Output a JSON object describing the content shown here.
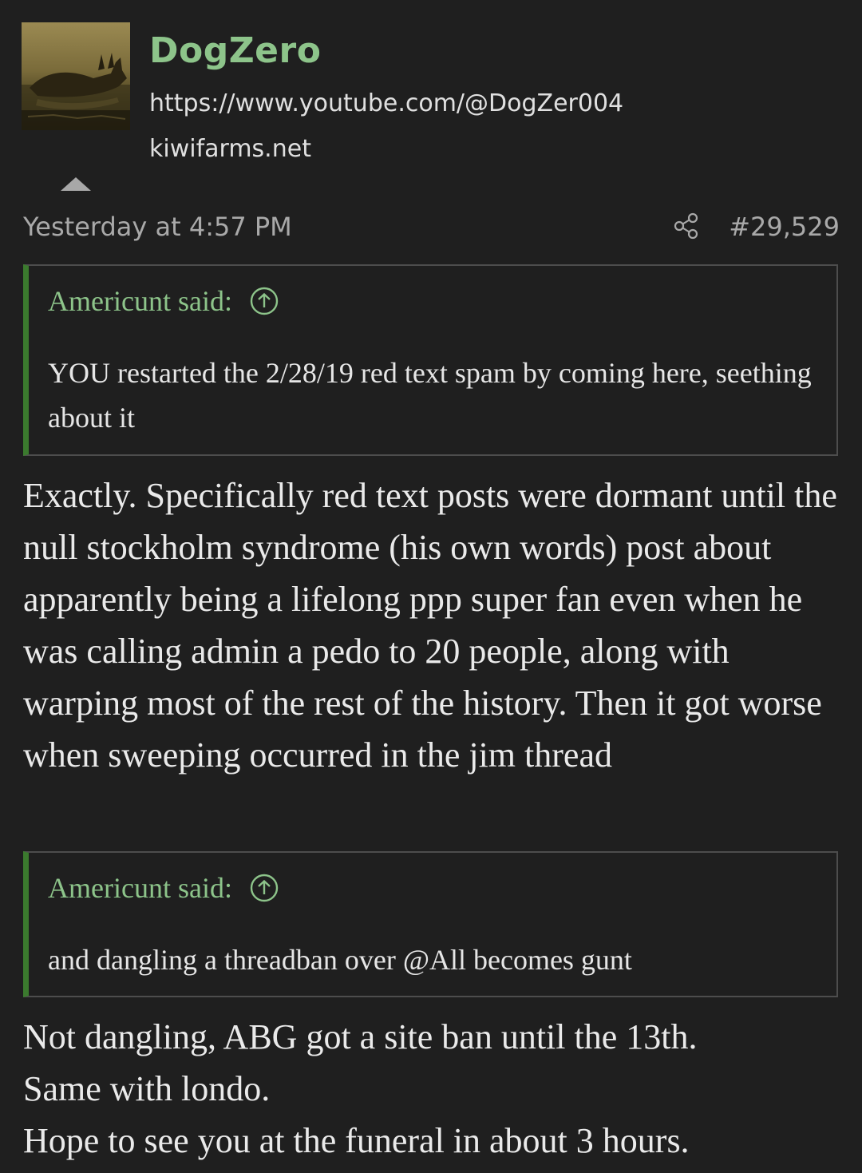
{
  "author": {
    "username": "DogZero",
    "signature_line_1": "https://www.youtube.com/@DogZer004",
    "signature_line_2": "kiwifarms.net"
  },
  "meta": {
    "timestamp": "Yesterday at 4:57 PM",
    "post_number": "#29,529"
  },
  "quotes": [
    {
      "attribution": "Americunt said:",
      "text": "YOU restarted the 2/28/19 red text spam by coming here, seething about it"
    },
    {
      "attribution": "Americunt said:",
      "text": "and dangling a threadban over @All becomes gunt"
    }
  ],
  "reply_1": "Exactly. Specifically red text posts were dormant until the null stockholm syndrome (his own words) post about apparently being a lifelong ppp super fan even when he was calling admin a pedo to 20 people, along with warping most of the rest of the history. Then it got worse when sweeping occurred in the jim thread",
  "reply_2": {
    "line_1": "Not dangling, ABG got a site ban until the 13th.",
    "line_2": "Same with londo.",
    "line_3": "Hope to see you at the funeral in about 3 hours."
  },
  "colors": {
    "background": "#1f1f1f",
    "username": "#8dc48a",
    "quote_accent": "#3b7a2e",
    "quote_border": "#4d4d4d",
    "meta_text": "#a9a9a9"
  },
  "icons": [
    "share-icon",
    "arrow-up-circle-icon",
    "collapse-arrow-icon",
    "avatar-image"
  ]
}
